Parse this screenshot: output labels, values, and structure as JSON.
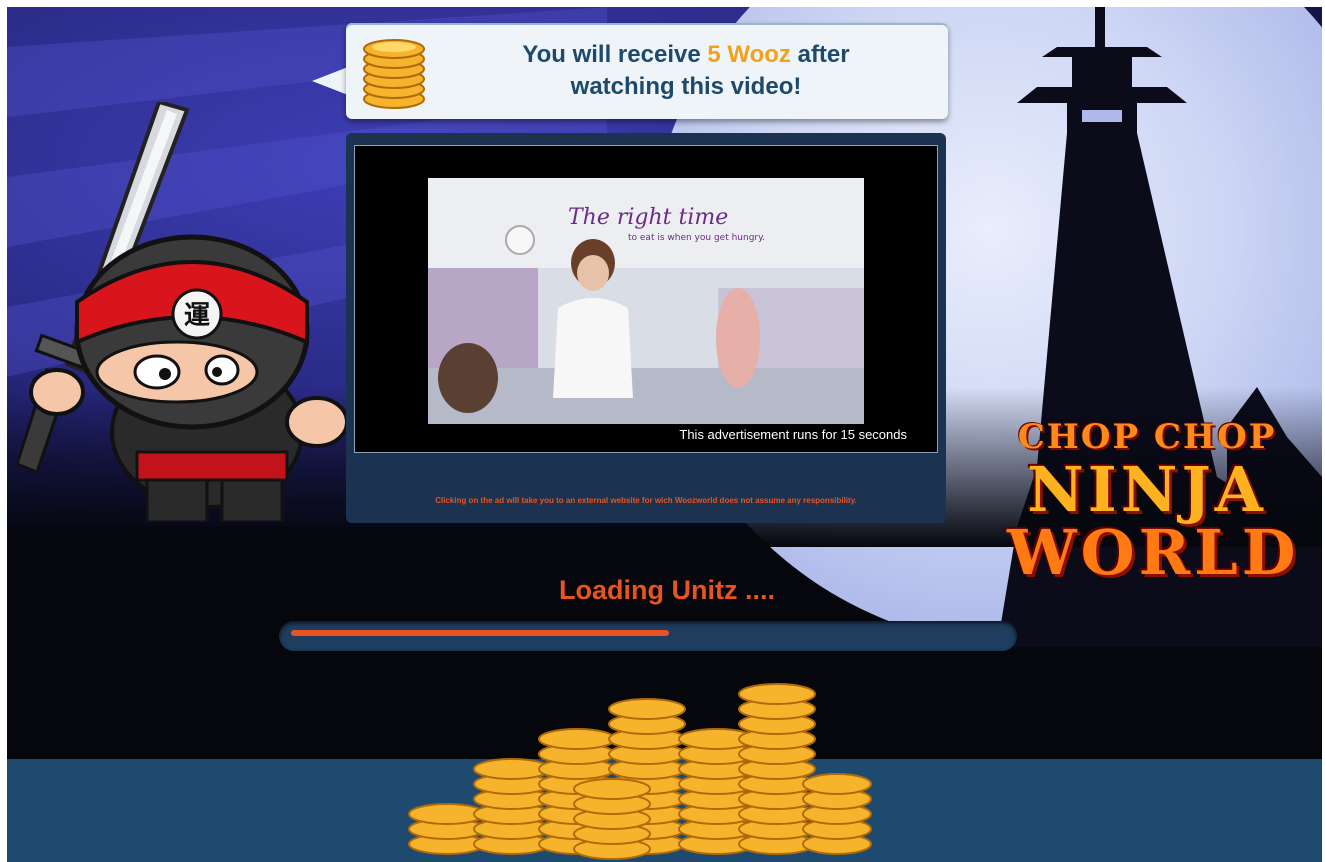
{
  "banner": {
    "prefix": "You will receive",
    "amount": "5 Wooz",
    "suffix_line1": "after",
    "line2": "watching this video!"
  },
  "video": {
    "ad_headline_1": "The right time",
    "ad_headline_2": "to eat is when you get hungry.",
    "timer_text": "This advertisement runs for 15 seconds",
    "disclaimer": "Clicking on the ad will take you to an external website for wich Woozworld does not assume any responsibility."
  },
  "logo": {
    "line1": "CHOP CHOP",
    "line2": "NINJA",
    "line3": "WORLD"
  },
  "loading": {
    "label": "Loading Unitz ....",
    "progress": 0.53
  },
  "ninja": {
    "headband_symbol": "運"
  },
  "colors": {
    "accent_orange": "#e8541f",
    "reward_gold": "#f2a21a",
    "panel_navy": "#1b3250",
    "floor_blue": "#1d4a6e"
  },
  "icons": [
    "coin-stack-icon",
    "ninja-mascot",
    "pagoda-tower",
    "moon"
  ]
}
